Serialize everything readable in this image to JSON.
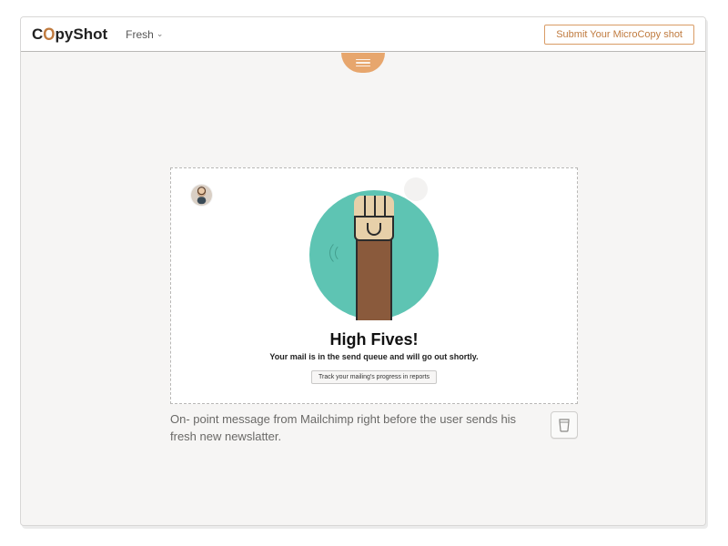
{
  "header": {
    "logo_pre": "C",
    "logo_o": "O",
    "logo_post": "pyShot",
    "nav_fresh": "Fresh",
    "submit_label": "Submit Your MicroCopy shot"
  },
  "card": {
    "headline": "High Fives!",
    "subline": "Your mail is in the send queue and will go out shortly.",
    "track_label": "Track your mailing's progress in reports"
  },
  "caption": "On- point message from Mailchimp right before the user sends his fresh new newslatter."
}
